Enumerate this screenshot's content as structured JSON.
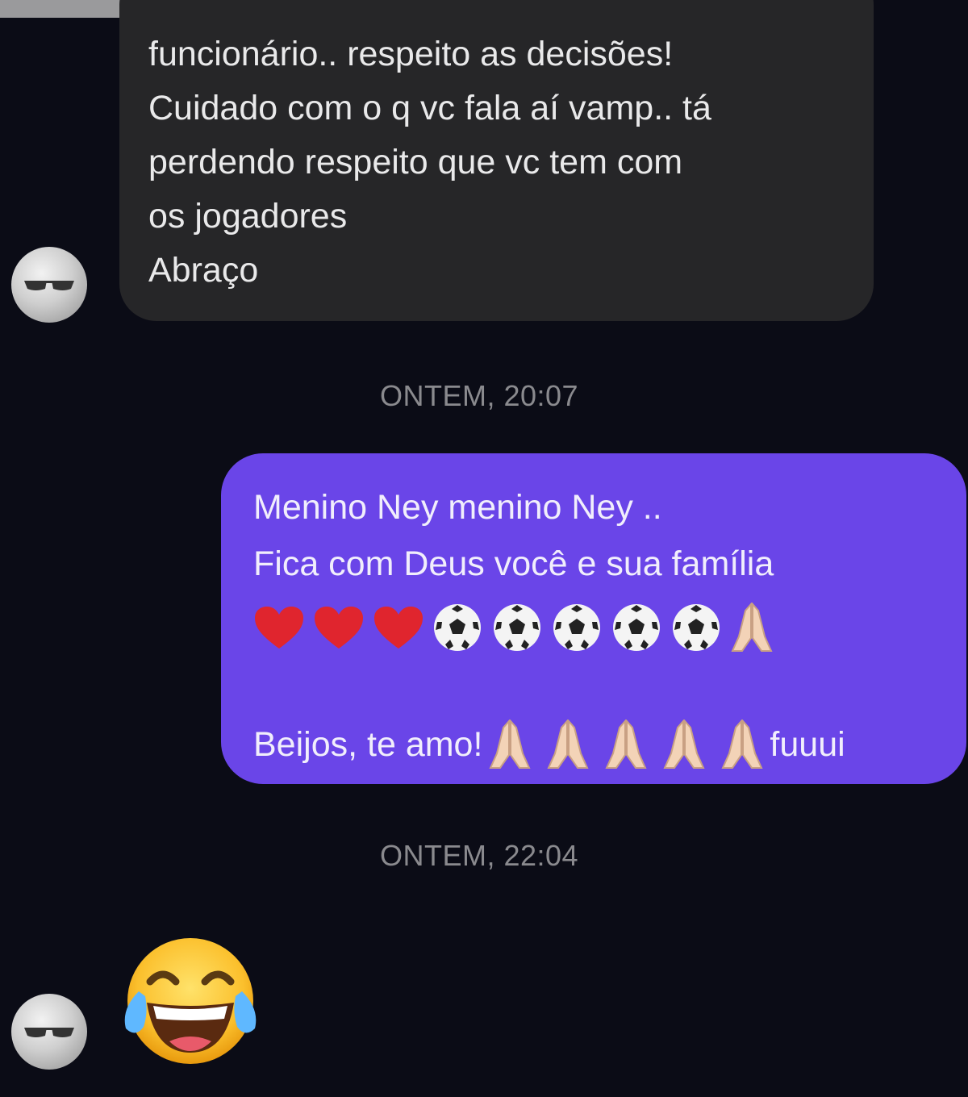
{
  "incoming_message_1": {
    "lines": [
      "funcionário.. respeito as decisões!",
      "Cuidado com o q vc fala aí vamp.. tá",
      "perdendo respeito que vc tem com",
      "os jogadores",
      "Abraço"
    ]
  },
  "timestamps": [
    "ONTEM, 20:07",
    "ONTEM, 22:04"
  ],
  "outgoing_message": {
    "line1": "Menino Ney menino Ney ..",
    "line2": "Fica com Deus você e sua família",
    "emoji_line": [
      "red-heart",
      "red-heart",
      "red-heart",
      "soccer-ball",
      "soccer-ball",
      "soccer-ball",
      "soccer-ball",
      "soccer-ball",
      "folded-hands"
    ],
    "line4_text": "Beijos, te amo!",
    "line4_emojis": [
      "folded-hands",
      "folded-hands",
      "folded-hands",
      "folded-hands",
      "folded-hands"
    ],
    "line4_suffix": "fuuui"
  },
  "incoming_message_2": {
    "emoji": "face-with-tears-of-joy"
  },
  "colors": {
    "background": "#0b0c16",
    "incoming_bubble": "#262628",
    "outgoing_bubble": "#6a45e8",
    "timestamp_text": "#8a8a8e"
  }
}
